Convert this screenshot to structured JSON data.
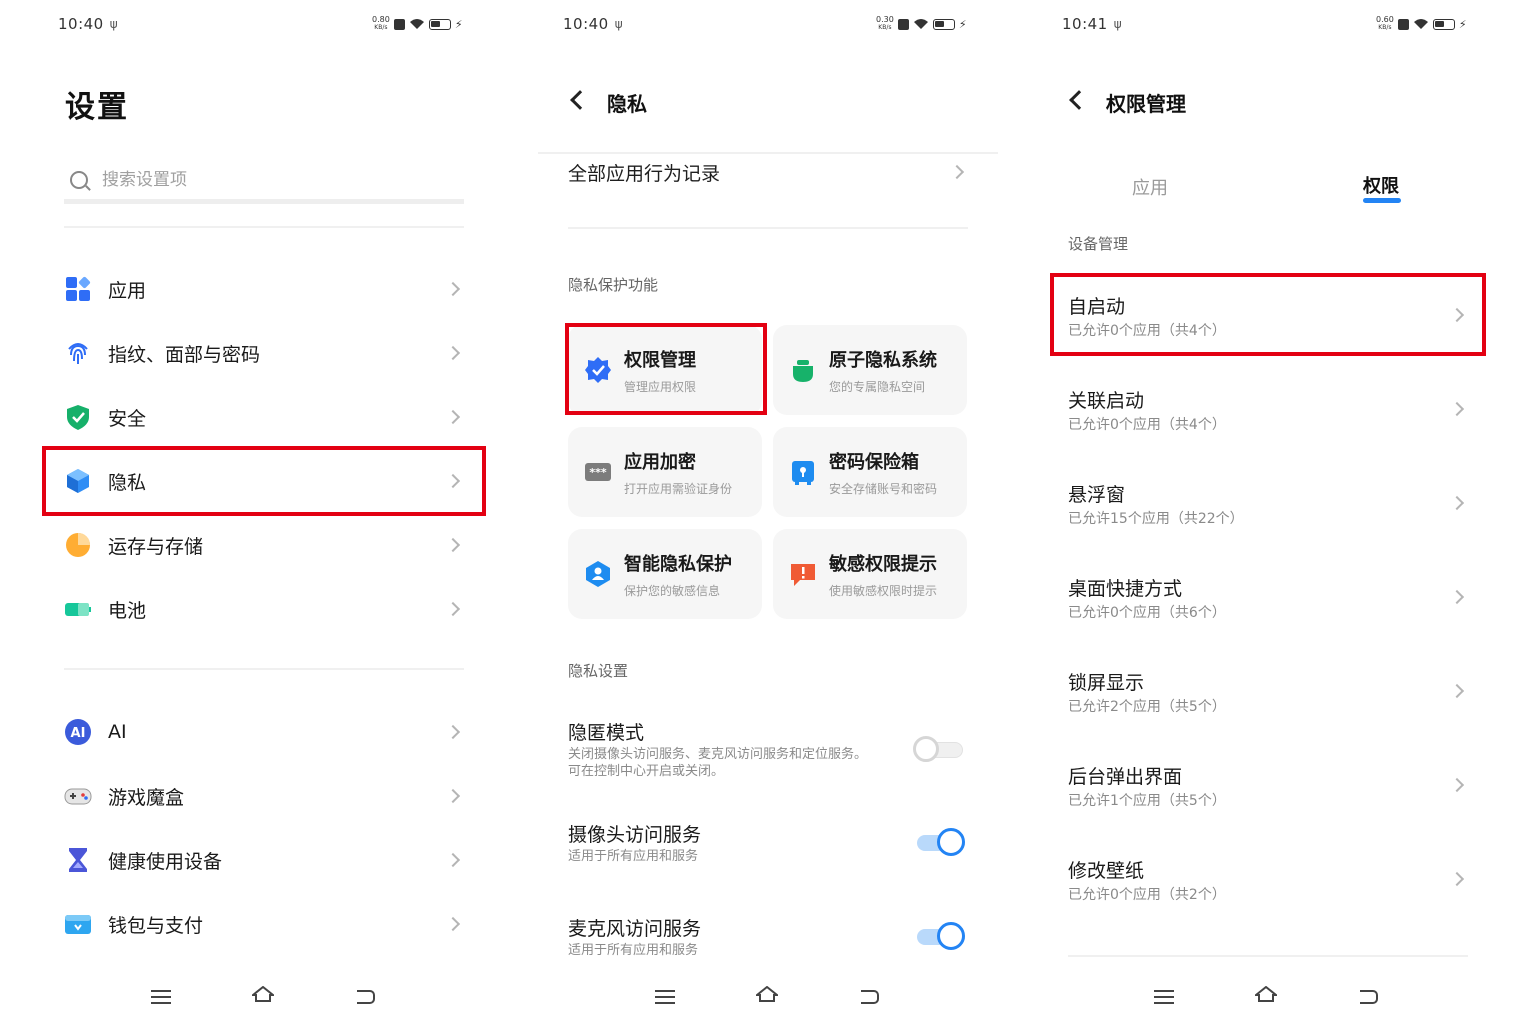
{
  "status_bars": [
    {
      "time": "10:40",
      "speed": "0.80",
      "unit": "KB/s"
    },
    {
      "time": "10:40",
      "speed": "0.30",
      "unit": "KB/s"
    },
    {
      "time": "10:41",
      "speed": "0.60",
      "unit": "KB/s"
    }
  ],
  "settings": {
    "title": "设置",
    "search_placeholder": "搜索设置项",
    "group1": [
      {
        "label": "应用",
        "icon": "apps-icon"
      },
      {
        "label": "指纹、面部与密码",
        "icon": "fingerprint-icon"
      },
      {
        "label": "安全",
        "icon": "shield-icon"
      },
      {
        "label": "隐私",
        "icon": "privacy-cube-icon"
      },
      {
        "label": "运存与存储",
        "icon": "storage-pie-icon"
      },
      {
        "label": "电池",
        "icon": "battery-icon"
      }
    ],
    "group2": [
      {
        "label": "AI",
        "icon": "ai-icon"
      },
      {
        "label": "游戏魔盒",
        "icon": "gamepad-icon"
      },
      {
        "label": "健康使用设备",
        "icon": "hourglass-icon"
      },
      {
        "label": "钱包与支付",
        "icon": "wallet-icon"
      }
    ]
  },
  "privacy": {
    "title": "隐私",
    "all_apps_record": "全部应用行为记录",
    "protection_section": "隐私保护功能",
    "cards": [
      {
        "title": "权限管理",
        "subtitle": "管理应用权限",
        "icon": "permission-badge-icon",
        "color": "#2f6df6"
      },
      {
        "title": "原子隐私系统",
        "subtitle": "您的专属隐私空间",
        "icon": "privacy-system-icon",
        "color": "#17b26a"
      },
      {
        "title": "应用加密",
        "subtitle": "打开应用需验证身份",
        "icon": "app-lock-icon",
        "color": "#7c7c7c"
      },
      {
        "title": "密码保险箱",
        "subtitle": "安全存储账号和密码",
        "icon": "password-vault-icon",
        "color": "#1e8cf0"
      },
      {
        "title": "智能隐私保护",
        "subtitle": "保护您的敏感信息",
        "icon": "smart-privacy-icon",
        "color": "#1e8cf0"
      },
      {
        "title": "敏感权限提示",
        "subtitle": "使用敏感权限时提示",
        "icon": "alert-icon",
        "color": "#f05b35"
      }
    ],
    "settings_section": "隐私设置",
    "prefs": [
      {
        "title": "隐匿模式",
        "desc": "关闭摄像头访问服务、麦克风访问服务和定位服务。可在控制中心开启或关闭。",
        "on": false
      },
      {
        "title": "摄像头访问服务",
        "desc": "适用于所有应用和服务",
        "on": true
      },
      {
        "title": "麦克风访问服务",
        "desc": "适用于所有应用和服务",
        "on": true
      }
    ]
  },
  "permissions": {
    "title": "权限管理",
    "tabs": [
      "应用",
      "权限"
    ],
    "active_tab": "权限",
    "section": "设备管理",
    "items": [
      {
        "title": "自启动",
        "sub": "已允许0个应用（共4个）"
      },
      {
        "title": "关联启动",
        "sub": "已允许0个应用（共4个）"
      },
      {
        "title": "悬浮窗",
        "sub": "已允许15个应用（共22个）"
      },
      {
        "title": "桌面快捷方式",
        "sub": "已允许0个应用（共6个）"
      },
      {
        "title": "锁屏显示",
        "sub": "已允许2个应用（共5个）"
      },
      {
        "title": "后台弹出界面",
        "sub": "已允许1个应用（共5个）"
      },
      {
        "title": "修改壁纸",
        "sub": "已允许0个应用（共2个）"
      }
    ]
  },
  "colors": {
    "accent": "#2384f4",
    "highlight": "#e30012",
    "toggle_on": "#2384f4"
  }
}
